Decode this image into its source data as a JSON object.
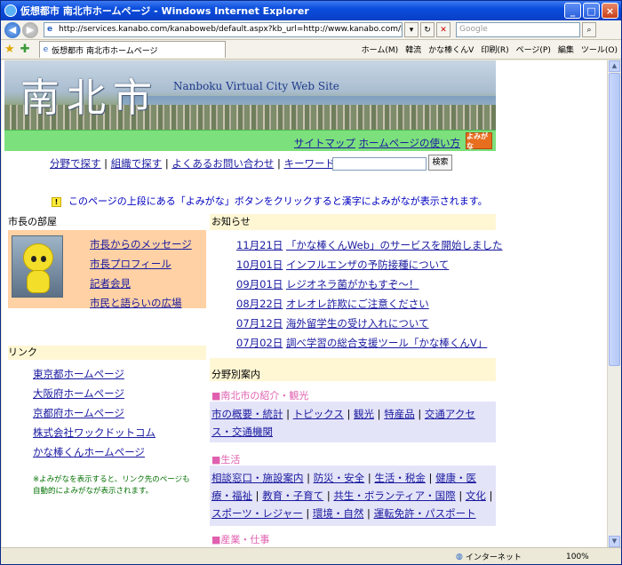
{
  "window": {
    "title": "仮想都市 南北市ホームページ - Windows Internet Explorer",
    "btn_min": "_",
    "btn_max": "□",
    "btn_close": "×"
  },
  "browser": {
    "url": "http://services.kanabo.com/kanaboweb/default.aspx?kb_url=http://www.kanabo.com/kanaboweb/nanboku/index.h",
    "search_placeholder": "Google",
    "tab_title": "仮想都市 南北市ホームページ",
    "tools": {
      "home": "ホーム(M)",
      "kanryu": "韓流",
      "kanabo": "かな棒くんV",
      "print": "印刷(R)",
      "page": "ページ(P)",
      "edit": "編集",
      "tool": "ツール(O)"
    }
  },
  "status": {
    "zone": "インターネット",
    "zoom": "100%"
  },
  "banner": {
    "title": "南北市",
    "subtitle": "Nanboku Virtual City Web Site"
  },
  "topLinks": {
    "sitemap": "サイトマップ",
    "howto": "ホームページの使い方",
    "yomigana": "よみがな"
  },
  "nav": {
    "bunya": "分野で探す",
    "soshiki": "組織で探す",
    "faq": "よくあるお問い合わせ",
    "keyword": "キーワード検索",
    "search_btn": "検索"
  },
  "notice": "このページの上段にある「よみがな」ボタンをクリックすると漢字によみがなが表示されます。",
  "mayor": {
    "heading": "市長の部屋",
    "links": [
      "市長からのメッセージ",
      "市長プロフィール",
      "記者会見",
      "市民と語らいの広場"
    ]
  },
  "news": {
    "heading": "お知らせ",
    "items": [
      {
        "date": "11月21日",
        "text": "「かな棒くんWeb」のサービスを開始しました"
      },
      {
        "date": "10月01日",
        "text": "インフルエンザの予防接種について"
      },
      {
        "date": "09月01日",
        "text": "レジオネラ菌がかもすぞ～！"
      },
      {
        "date": "08月22日",
        "text": "オレオレ詐欺にご注意ください"
      },
      {
        "date": "07月12日",
        "text": "海外留学生の受け入れについて"
      },
      {
        "date": "07月02日",
        "text": "調べ学習の総合支援ツール「かな棒くんV」"
      }
    ]
  },
  "links": {
    "heading": "リンク",
    "items": [
      "東京都ホームページ",
      "大阪府ホームページ",
      "京都府ホームページ",
      "株式会社ワックドットコム",
      "かな棒くんホームページ"
    ],
    "note1": "※よみがなを表示すると、リンク先のページも",
    "note2": "自動的によみがなが表示されます。"
  },
  "categories": {
    "heading": "分野別案内",
    "sections": [
      {
        "title": "■南北市の紹介・観光",
        "items": [
          "市の概要・統計",
          "トピックス",
          "観光",
          "特産品",
          "交通アクセス・交通機関"
        ]
      },
      {
        "title": "■生活",
        "items": [
          "相談窓口・施設案内",
          "防災・安全",
          "生活・税金",
          "健康・医療・福祉",
          "教育・子育て",
          "共生・ボランティア・国際",
          "文化",
          "スポーツ・レジャー",
          "環境・自然",
          "運転免許・パスポート"
        ]
      },
      {
        "title": "■産業・仕事",
        "items": []
      }
    ]
  }
}
